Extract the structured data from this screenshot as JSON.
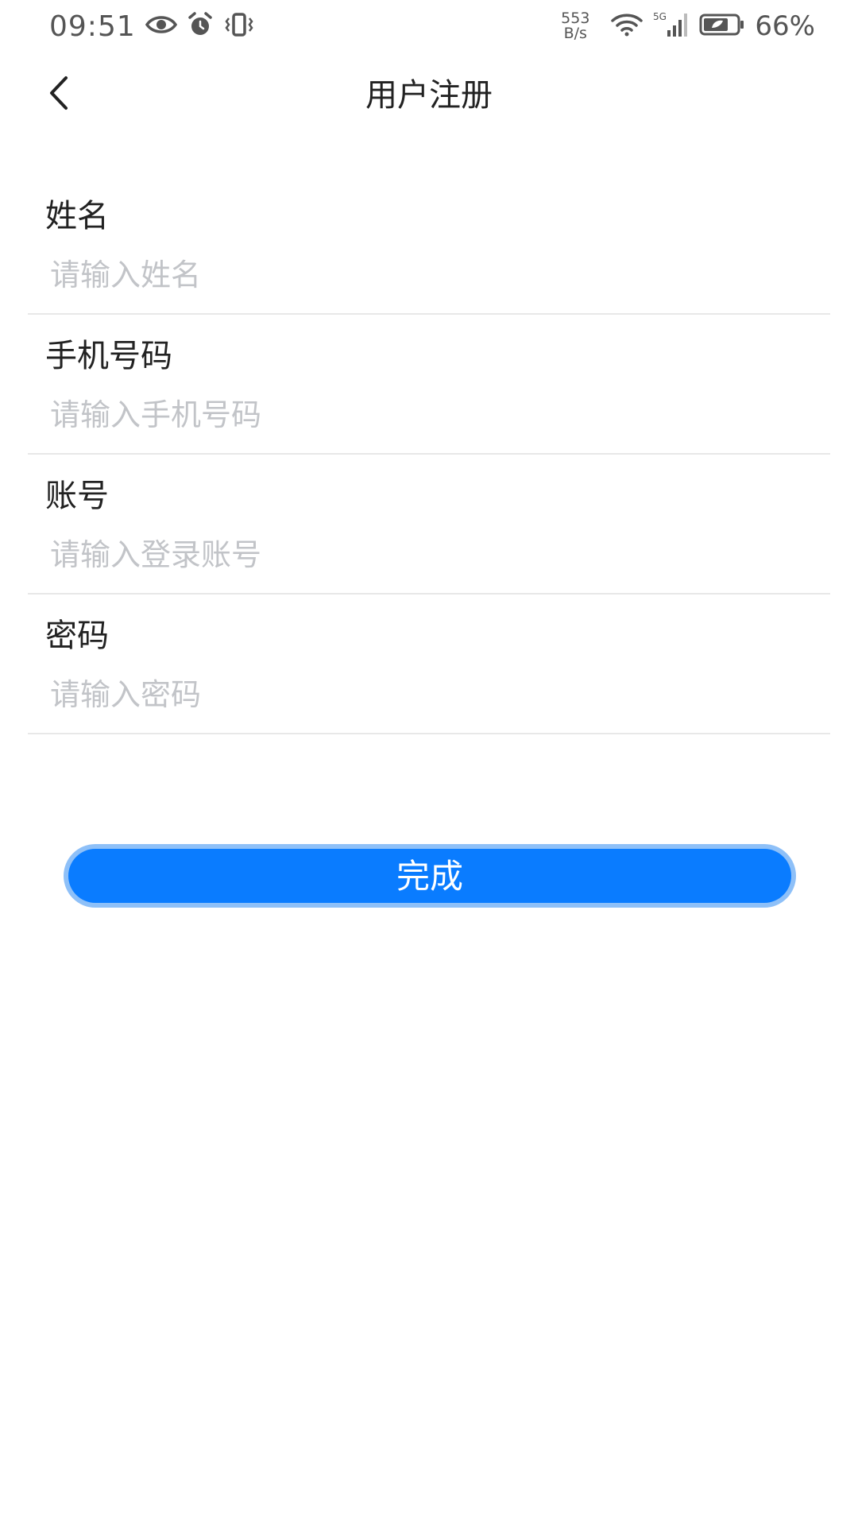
{
  "status_bar": {
    "time": "09:51",
    "net_speed_value": "553",
    "net_speed_unit": "B/s",
    "network": "5G",
    "battery": "66%",
    "icons": [
      "eye-icon",
      "alarm-icon",
      "vibrate-icon",
      "wifi-icon",
      "signal-icon",
      "battery-icon"
    ]
  },
  "nav": {
    "title": "用户注册",
    "back_icon": "chevron-left-icon"
  },
  "form": {
    "fields": [
      {
        "label": "姓名",
        "placeholder": "请输入姓名",
        "value": ""
      },
      {
        "label": "手机号码",
        "placeholder": "请输入手机号码",
        "value": ""
      },
      {
        "label": "账号",
        "placeholder": "请输入登录账号",
        "value": ""
      },
      {
        "label": "密码",
        "placeholder": "请输入密码",
        "value": ""
      }
    ]
  },
  "submit": {
    "label": "完成"
  },
  "colors": {
    "accent": "#0a7cff",
    "accent_glow": "#8ec0f8",
    "placeholder": "#c2c4c8",
    "divider": "#e8e8e8",
    "text": "#222222"
  }
}
